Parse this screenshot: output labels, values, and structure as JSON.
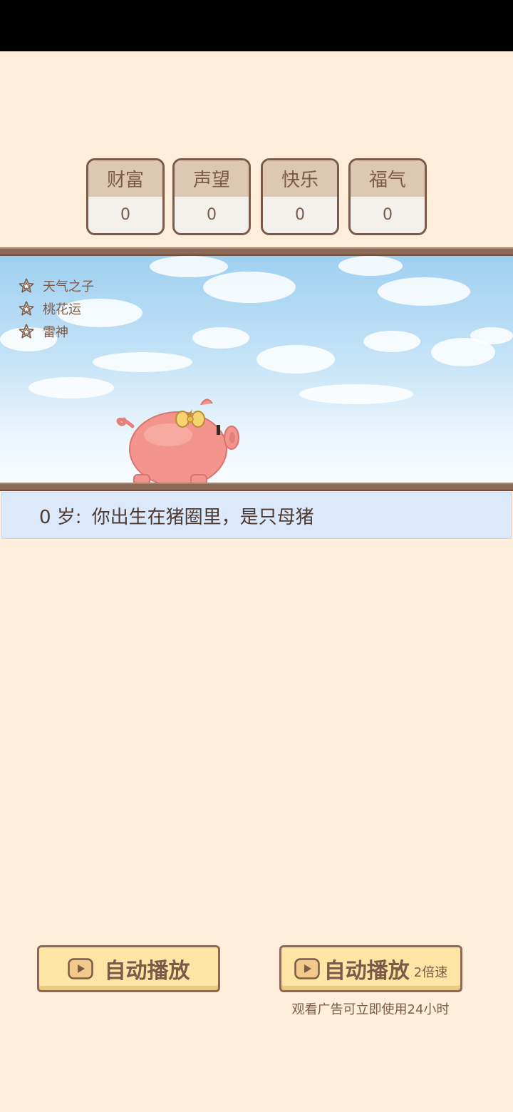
{
  "stats": [
    {
      "label": "财富",
      "value": "0"
    },
    {
      "label": "声望",
      "value": "0"
    },
    {
      "label": "快乐",
      "value": "0"
    },
    {
      "label": "福气",
      "value": "0"
    }
  ],
  "traits": [
    "天气之子",
    "桃花运",
    "雷神"
  ],
  "event": {
    "age": "0 岁:",
    "text": "你出生在猪圈里，是只母猪"
  },
  "buttons": {
    "autoplay_label": "自动播放",
    "autoplay2x_label": "自动播放",
    "autoplay2x_suffix": "2倍速",
    "ad_note": "观看广告可立即使用24小时"
  },
  "icons": {
    "trait": "star-icon",
    "button": "video-play-icon"
  },
  "colors": {
    "background": "#feeedb",
    "brown": "#7b5a4a",
    "button": "#fde5a6",
    "pig": "#f3958c"
  }
}
